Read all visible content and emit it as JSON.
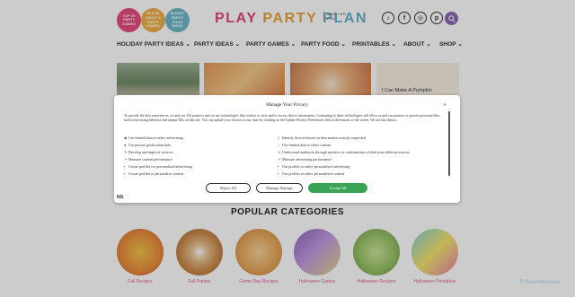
{
  "header": {
    "badges": [
      {
        "text": "TOP 25 PARTY GAMES",
        "color": "#e44b80"
      },
      {
        "text": "50 FUN ADULT & PARTY GAMES",
        "color": "#efb04a"
      },
      {
        "text": "45 BEST PARTY FOOD IDEAS",
        "color": "#6eb7c8"
      }
    ],
    "logo_words": [
      "PLAY",
      "PARTY",
      "PLAN"
    ],
    "tagline": "MAKE LIFE FUN",
    "social_icons": [
      "tiktok-icon",
      "facebook-icon",
      "instagram-icon",
      "pinterest-icon"
    ],
    "accent": "#8a68b2"
  },
  "nav": [
    {
      "label": "HOLIDAY PARTY IDEAS"
    },
    {
      "label": "PARTY IDEAS"
    },
    {
      "label": "PARTY GAMES"
    },
    {
      "label": "PARTY FOOD"
    },
    {
      "label": "PRINTABLES"
    },
    {
      "label": "ABOUT"
    },
    {
      "label": "SHOP"
    }
  ],
  "thumbs": [
    {
      "caption": ""
    },
    {
      "caption": ""
    },
    {
      "caption": ""
    },
    {
      "caption": "I Can Make A Pumpkin"
    }
  ],
  "modal": {
    "title": "Manage Your Privacy",
    "body": "To provide the best experiences, we and our 145 partners and we use technologies like cookies to store and/or access device information. Consenting to these technologies will allow us and our partners to process personal data, such as browsing behavior and unique IDs, on this site. You can update your choices at any time by clicking on the Update Privacy Preferences link at the bottom of the screen. We use this data to:",
    "purposes_left": [
      "Use limited data to select advertising",
      "Use precise geolocation data",
      "Develop and improve services",
      "Measure content performance",
      "Create profiles for personalised advertising",
      "Create profiles to personalise content"
    ],
    "purposes_right": [
      "Identify devices based on information actively requested",
      "Use limited data to select content",
      "Understand audiences through statistics or combinations of data from different sources",
      "Measure advertising performance",
      "Use profiles to select personalised advertising",
      "Use profiles to select personalised content"
    ],
    "reject_label": "Reject All",
    "manage_label": "Manage Settings",
    "accept_label": "Accept All",
    "close_label": "×",
    "logo": "NG",
    "accept_color": "#3aa454"
  },
  "categories": {
    "title": "POPULAR CATEGORIES",
    "items": [
      {
        "label": "Fall Recipes"
      },
      {
        "label": "Fall Parties"
      },
      {
        "label": "Game Day Recipes"
      },
      {
        "label": "Halloween Games"
      },
      {
        "label": "Halloween Recipes"
      },
      {
        "label": "Halloween Printables"
      }
    ]
  },
  "watermark": "ScamMalware"
}
